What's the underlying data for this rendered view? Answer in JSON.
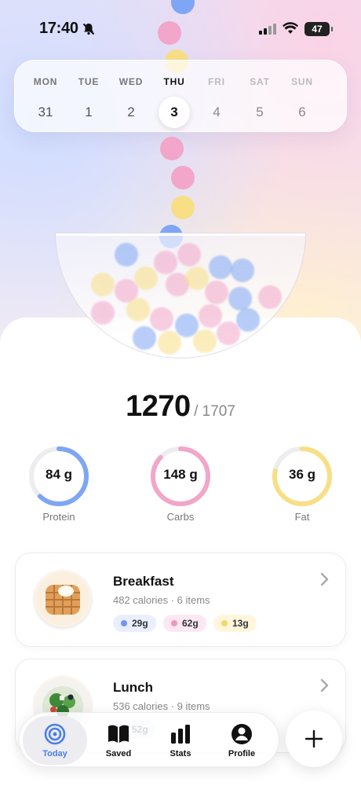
{
  "status_bar": {
    "time": "17:40",
    "battery": "47"
  },
  "week": [
    {
      "name": "MON",
      "date": "31",
      "state": "past"
    },
    {
      "name": "TUE",
      "date": "1",
      "state": "past"
    },
    {
      "name": "WED",
      "date": "2",
      "state": "past"
    },
    {
      "name": "THU",
      "date": "3",
      "state": "selected"
    },
    {
      "name": "FRI",
      "date": "4",
      "state": "future"
    },
    {
      "name": "SAT",
      "date": "5",
      "state": "future"
    },
    {
      "name": "SUN",
      "date": "6",
      "state": "future"
    }
  ],
  "calories": {
    "value": "1270",
    "goal": "/ 1707"
  },
  "macros": [
    {
      "value": "84 g",
      "label": "Protein",
      "fraction": 0.62,
      "color": "#7ea6f4"
    },
    {
      "value": "148 g",
      "label": "Carbs",
      "fraction": 0.87,
      "color": "#f2a6c9"
    },
    {
      "value": "36 g",
      "label": "Fat",
      "fraction": 0.78,
      "color": "#f8df85"
    }
  ],
  "meals": [
    {
      "title": "Breakfast",
      "subtitle": "482 calories · 6 items",
      "protein": "29g",
      "carbs": "62g",
      "fat": "13g"
    },
    {
      "title": "Lunch",
      "subtitle": "536 calories · 9 items",
      "protein": "52g",
      "carbs": "",
      "fat": ""
    }
  ],
  "nav": [
    {
      "label": "Today",
      "icon": "target-icon",
      "active": true
    },
    {
      "label": "Saved",
      "icon": "book-icon",
      "active": false
    },
    {
      "label": "Stats",
      "icon": "bar-chart-icon",
      "active": false
    },
    {
      "label": "Profile",
      "icon": "user-icon",
      "active": false
    }
  ],
  "colors": {
    "protein": "#7ea6f4",
    "carbs": "#f2a6c9",
    "fat": "#f8df85",
    "accent": "#4a7fe8"
  }
}
